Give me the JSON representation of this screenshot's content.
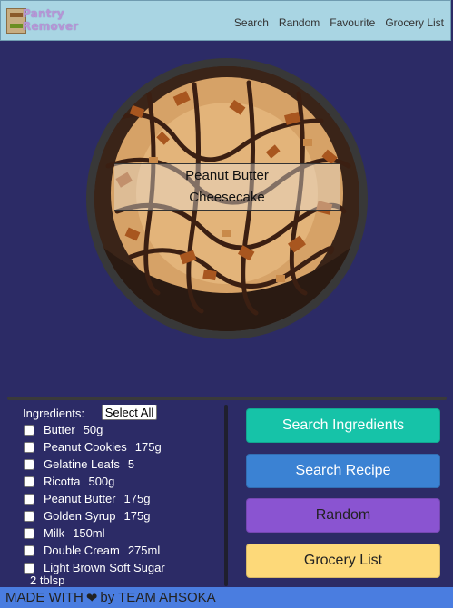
{
  "header": {
    "logo_line1": "Pantry",
    "logo_line2": "Remover",
    "nav": [
      "Search",
      "Random",
      "Favourite",
      "Grocery List"
    ]
  },
  "recipe": {
    "title": "Peanut Butter Cheesecake"
  },
  "ingredients": {
    "label": "Ingredients:",
    "select_all": "Select All",
    "items": [
      {
        "name": "Butter",
        "qty": "50g"
      },
      {
        "name": "Peanut Cookies",
        "qty": "175g"
      },
      {
        "name": "Gelatine Leafs",
        "qty": "5"
      },
      {
        "name": "Ricotta",
        "qty": "500g"
      },
      {
        "name": "Peanut Butter",
        "qty": "175g"
      },
      {
        "name": "Golden Syrup",
        "qty": "175g"
      },
      {
        "name": "Milk",
        "qty": "150ml"
      },
      {
        "name": "Double Cream",
        "qty": "275ml"
      },
      {
        "name": "Light Brown Soft Sugar",
        "qty": "2 tblsp"
      }
    ]
  },
  "buttons": {
    "search_ingredients": "Search Ingredients",
    "search_recipe": "Search Recipe",
    "random": "Random",
    "grocery_list": "Grocery List"
  },
  "footer": {
    "prefix": "MADE WITH",
    "suffix": "by TEAM AHSOKA"
  },
  "colors": {
    "background": "#2c2b66",
    "header": "#a9d5e3",
    "footer": "#4a7de0",
    "btn_search_ingredients": "#16c3a8",
    "btn_search_recipe": "#3b82d3",
    "btn_random": "#8a54d1",
    "btn_grocery": "#fdd979"
  }
}
